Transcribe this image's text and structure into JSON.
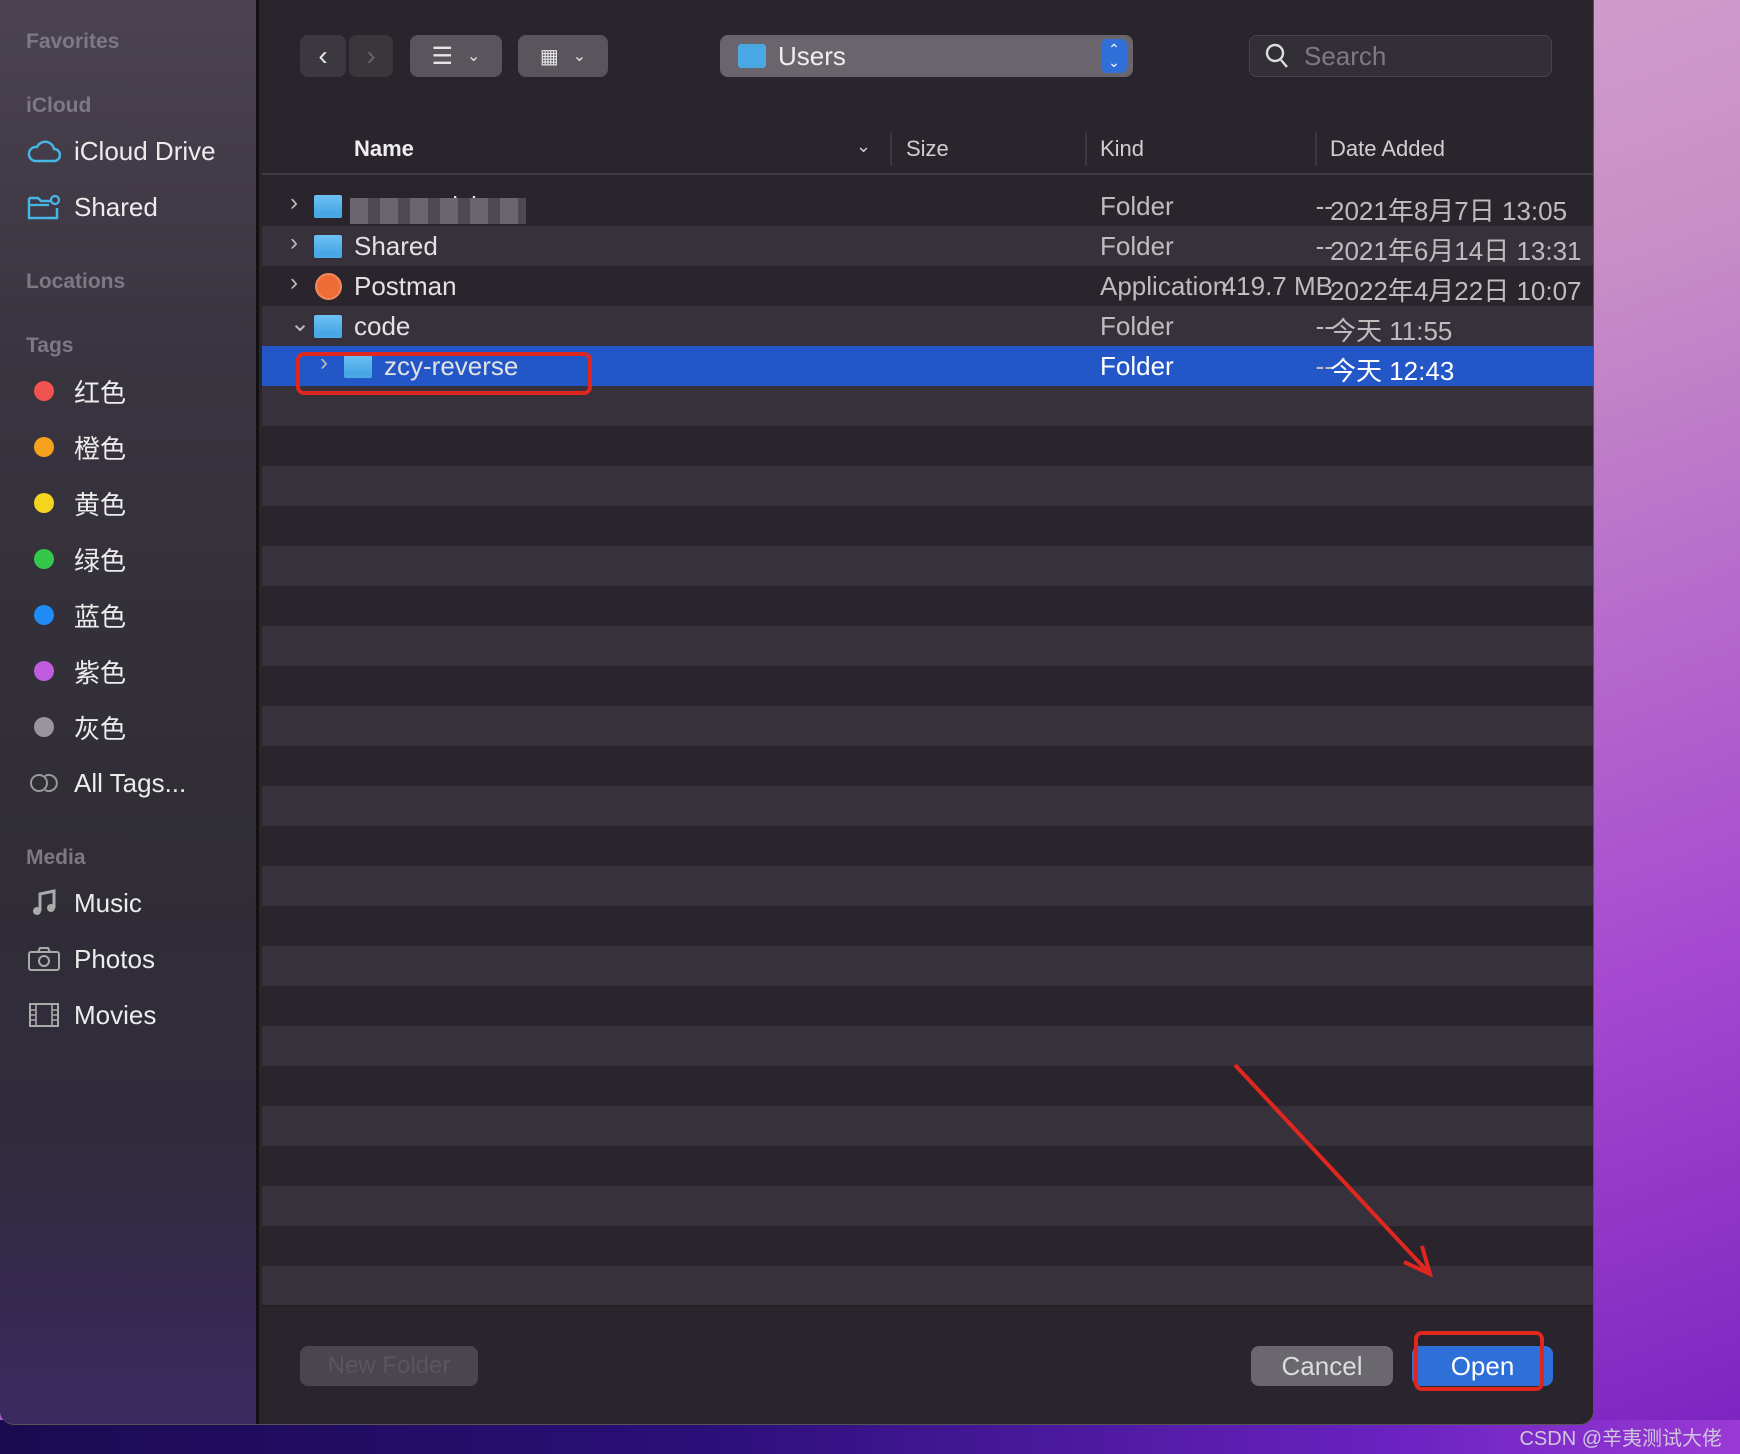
{
  "sidebar": {
    "favorites": "Favorites",
    "icloud": "iCloud",
    "icloud_items": [
      {
        "label": "iCloud Drive",
        "icon": "cloud-icon"
      },
      {
        "label": "Shared",
        "icon": "shared-folder-icon"
      }
    ],
    "locations": "Locations",
    "tags_header": "Tags",
    "tags": [
      {
        "label": "红色",
        "color": "#f0524f"
      },
      {
        "label": "橙色",
        "color": "#f6a21e"
      },
      {
        "label": "黄色",
        "color": "#f5d41f"
      },
      {
        "label": "绿色",
        "color": "#34c84a"
      },
      {
        "label": "蓝色",
        "color": "#1e8cf4"
      },
      {
        "label": "紫色",
        "color": "#c05ce0"
      },
      {
        "label": "灰色",
        "color": "#98969c"
      }
    ],
    "all_tags": "All Tags...",
    "media": "Media",
    "media_items": [
      {
        "label": "Music",
        "icon": "music-note-icon"
      },
      {
        "label": "Photos",
        "icon": "camera-icon"
      },
      {
        "label": "Movies",
        "icon": "film-icon"
      }
    ]
  },
  "toolbar": {
    "location": "Users",
    "search_placeholder": "Search"
  },
  "columns": {
    "name": "Name",
    "size": "Size",
    "kind": "Kind",
    "date": "Date Added"
  },
  "files": [
    {
      "name": "wangmeichen",
      "size": "--",
      "kind": "Folder",
      "date": "2021年8月7日 13:05",
      "icon": "home-folder",
      "expanded": false,
      "indent": 0,
      "selected": false
    },
    {
      "name": "Shared",
      "size": "--",
      "kind": "Folder",
      "date": "2021年6月14日 13:31",
      "icon": "folder",
      "expanded": false,
      "indent": 0,
      "selected": false
    },
    {
      "name": "Postman",
      "size": "419.7 MB",
      "kind": "Application",
      "date": "2022年4月22日 10:07",
      "icon": "postman-app",
      "expanded": false,
      "indent": 0,
      "selected": false
    },
    {
      "name": "code",
      "size": "--",
      "kind": "Folder",
      "date": "今天 11:55",
      "icon": "folder",
      "expanded": true,
      "indent": 0,
      "selected": false
    },
    {
      "name": "zcy-reverse",
      "size": "--",
      "kind": "Folder",
      "date": "今天 12:43",
      "icon": "folder",
      "expanded": false,
      "indent": 1,
      "selected": true
    }
  ],
  "footer": {
    "new_folder": "New Folder",
    "cancel": "Cancel",
    "open": "Open"
  },
  "colors": {
    "selection": "#2357c8",
    "annotation": "#e0271f",
    "accent": "#2f6fd8"
  },
  "watermark": "CSDN @辛夷测试大佬"
}
